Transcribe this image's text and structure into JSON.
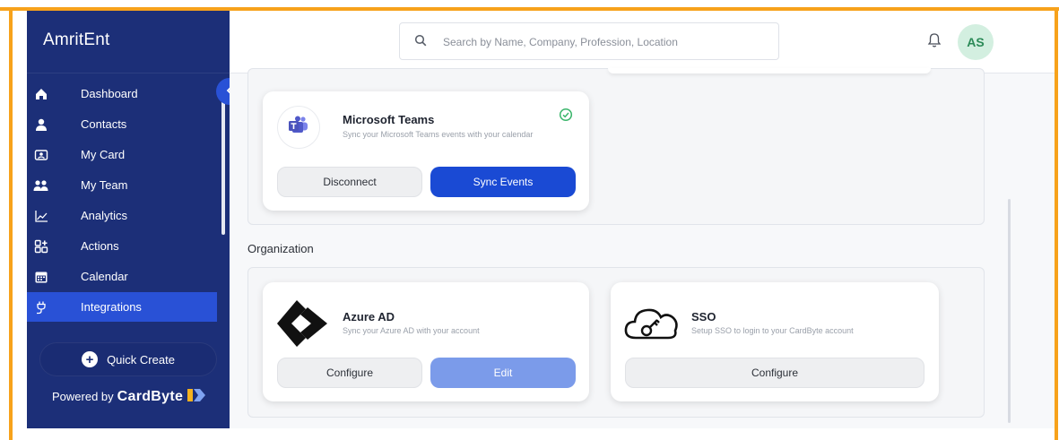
{
  "app": {
    "brand": "AmritEnt"
  },
  "sidebar": {
    "items": [
      {
        "label": "Dashboard",
        "icon": "home-icon"
      },
      {
        "label": "Contacts",
        "icon": "person-icon"
      },
      {
        "label": "My Card",
        "icon": "id-card-icon"
      },
      {
        "label": "My Team",
        "icon": "team-icon"
      },
      {
        "label": "Analytics",
        "icon": "chart-icon"
      },
      {
        "label": "Actions",
        "icon": "grid-plus-icon"
      },
      {
        "label": "Calendar",
        "icon": "calendar-icon"
      },
      {
        "label": "Integrations",
        "icon": "plug-icon",
        "active": true
      }
    ],
    "quick_create": "Quick Create",
    "powered_by": "Powered by",
    "powered_brand": "CardByte"
  },
  "header": {
    "search_placeholder": "Search by Name, Company, Profession, Location",
    "avatar_initials": "AS"
  },
  "integrations": {
    "teams": {
      "title": "Microsoft Teams",
      "description": "Sync your Microsoft Teams events with your calendar",
      "disconnect_label": "Disconnect",
      "sync_label": "Sync Events",
      "connected": true
    }
  },
  "organization": {
    "heading": "Organization",
    "azure": {
      "title": "Azure AD",
      "description": "Sync your Azure AD with your account",
      "configure_label": "Configure",
      "edit_label": "Edit"
    },
    "sso": {
      "title": "SSO",
      "description": "Setup SSO to login to your CardByte account",
      "configure_label": "Configure"
    }
  },
  "colors": {
    "sidebar_bg": "#1c2f78",
    "accent": "#1a4ad4",
    "frame": "#f7a21b",
    "success": "#3bb56b"
  }
}
